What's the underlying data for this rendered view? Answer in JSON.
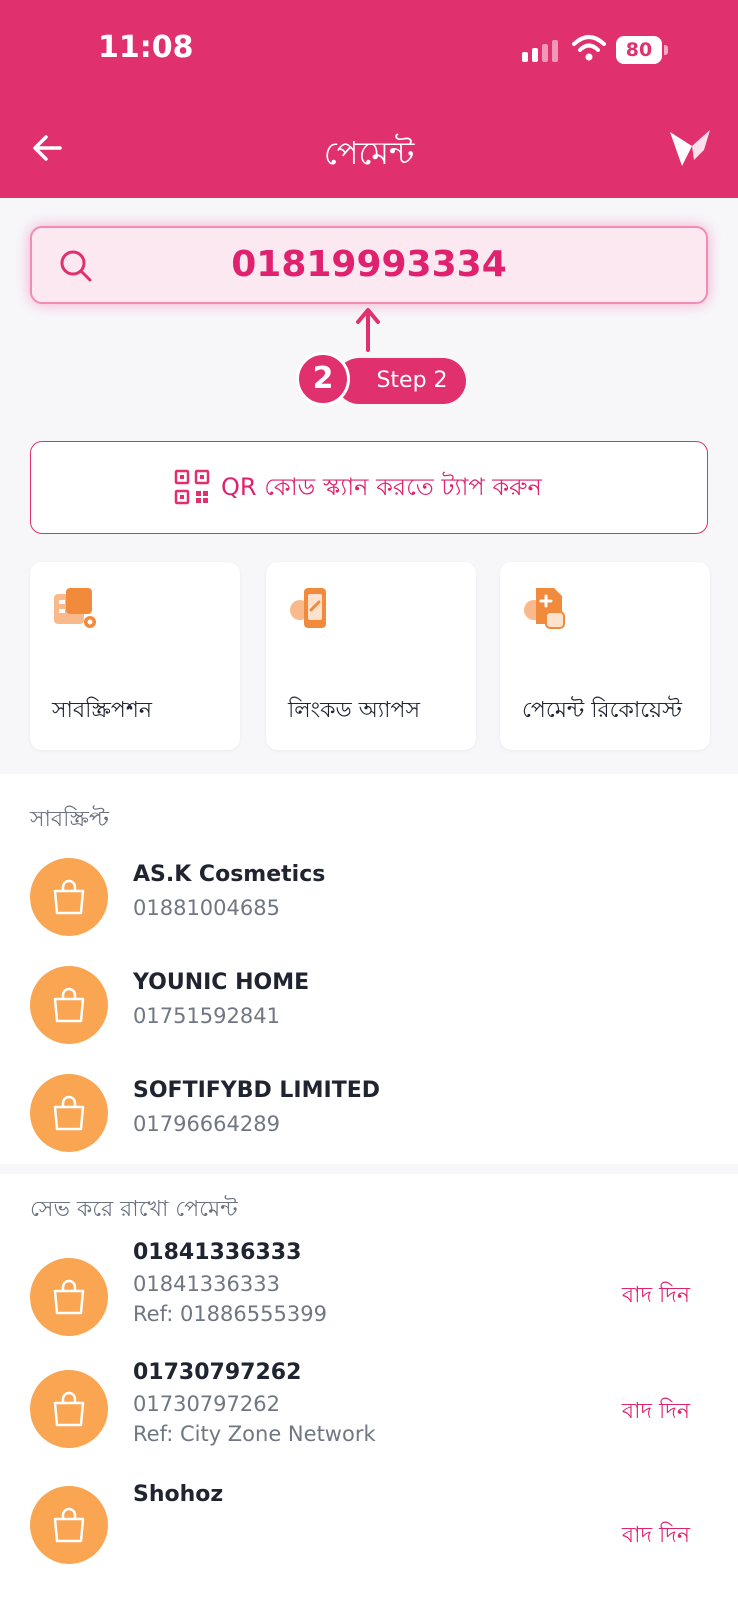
{
  "status_bar": {
    "time": "11:08",
    "battery": "80"
  },
  "header": {
    "title": "পেমেন্ট"
  },
  "search": {
    "value": "01819993334"
  },
  "step": {
    "number": "2",
    "label": "Step 2"
  },
  "qr_button": {
    "label": "QR কোড স্ক্যান করতে ট্যাপ করুন"
  },
  "tiles": [
    {
      "label": "সাবস্ক্রিপশন",
      "icon": "subscription-icon"
    },
    {
      "label": "লিংকড অ্যাপস",
      "icon": "linked-apps-icon"
    },
    {
      "label": "পেমেন্ট রিকোয়েস্ট",
      "icon": "payment-request-icon"
    }
  ],
  "subscribed": {
    "title": "সাবস্ক্রিপ্ট",
    "items": [
      {
        "name": "AS.K Cosmetics",
        "number": "01881004685"
      },
      {
        "name": "YOUNIC HOME",
        "number": "01751592841"
      },
      {
        "name": "SOFTIFYBD LIMITED",
        "number": "01796664289"
      }
    ]
  },
  "saved": {
    "title": "সেভ করে রাখো পেমেন্ট",
    "remove_label": "বাদ দিন",
    "items": [
      {
        "name": "01841336333",
        "number": "01841336333",
        "ref": "Ref: 01886555399"
      },
      {
        "name": "01730797262",
        "number": "01730797262",
        "ref": "Ref: City Zone Network"
      },
      {
        "name": "Shohoz",
        "number": "",
        "ref": ""
      }
    ]
  },
  "colors": {
    "brand": "#e0306d",
    "avatar": "#f9a552",
    "tile_icon": "#f28a3c"
  }
}
